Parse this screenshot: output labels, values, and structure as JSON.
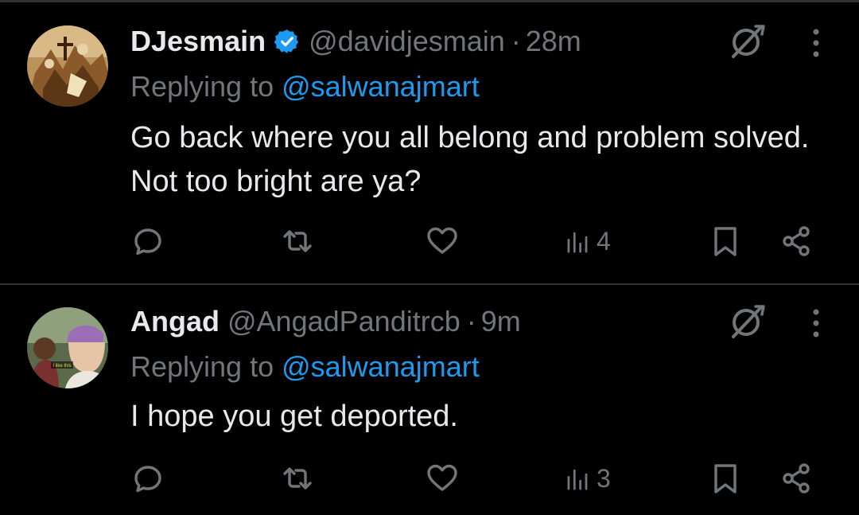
{
  "tweets": [
    {
      "display_name": "DJesmain",
      "verified": true,
      "handle": "@davidjesmain",
      "separator": "·",
      "time": "28m",
      "replying_prefix": "Replying to ",
      "replying_to": "@salwanajmart",
      "text": "Go back where you all belong and problem solved. Not too bright are ya?",
      "views": "4"
    },
    {
      "display_name": "Angad",
      "verified": false,
      "handle": "@AngadPanditrcb",
      "separator": "·",
      "time": "9m",
      "replying_prefix": "Replying to ",
      "replying_to": "@salwanajmart",
      "text": "I hope you get deported.",
      "views": "3",
      "avatar_caption": "I like this"
    }
  ],
  "colors": {
    "background": "#000000",
    "text_primary": "#e7e9ea",
    "text_secondary": "#71767b",
    "accent": "#1d9bf0",
    "divider": "#2f3336"
  },
  "icons": [
    "verified-badge-icon",
    "grok-icon",
    "more-icon",
    "reply-icon",
    "retweet-icon",
    "like-icon",
    "views-icon",
    "bookmark-icon",
    "share-icon"
  ]
}
